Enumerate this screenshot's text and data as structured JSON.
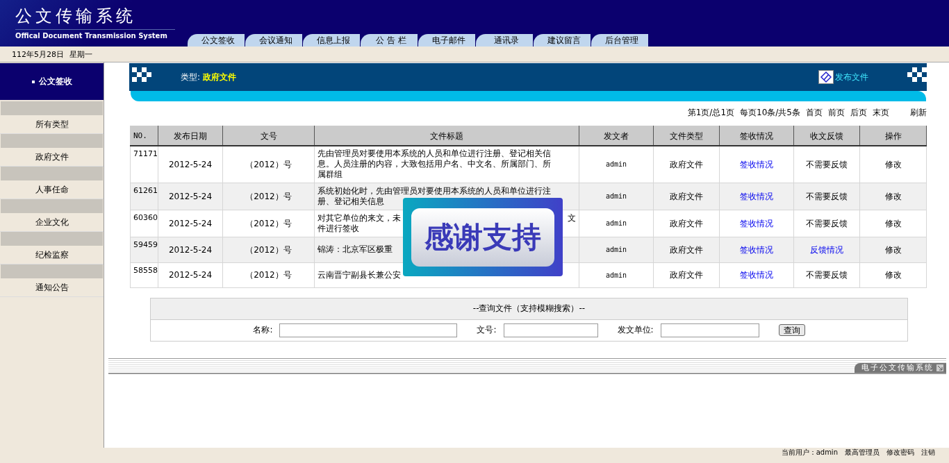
{
  "header": {
    "title": "公文传输系统",
    "subtitle": "Offical Document Transmission System"
  },
  "tabs": [
    "公文签收",
    "会议通知",
    "信息上报",
    "公 告 栏",
    "电子邮件",
    "通讯录",
    "建议留言",
    "后台管理"
  ],
  "date": {
    "day": "112年5月28日",
    "weekday": "星期一"
  },
  "sidebar": {
    "heading": "公文签收",
    "items": [
      "所有类型",
      "政府文件",
      "人事任命",
      "企业文化",
      "纪检监察",
      "通知公告"
    ]
  },
  "banner": {
    "type_label": "类型:",
    "type_value": "政府文件",
    "action": "发布文件"
  },
  "pagination": [
    {
      "label": "第1页/总1页",
      "kind": "text"
    },
    {
      "label": "每页10条/共5条",
      "kind": "text"
    },
    {
      "label": "首页",
      "kind": "link"
    },
    {
      "label": "前页",
      "kind": "link"
    },
    {
      "label": "后页",
      "kind": "link"
    },
    {
      "label": "末页",
      "kind": "link"
    },
    {
      "label": "刷新",
      "kind": "refresh"
    }
  ],
  "table": {
    "columns": [
      "NO.",
      "发布日期",
      "文号",
      "文件标题",
      "发文者",
      "文件类型",
      "签收情况",
      "收文反馈",
      "操作"
    ],
    "rows": [
      {
        "no": "71171",
        "date": "2012-5-24",
        "number": "（2012）号",
        "title_lines": [
          [
            "先由管理员对要使用本系统的人员和单位进行注册、登记相关信"
          ],
          [
            "息。人员注册的内容，大致包括用户名、中文名、所属部门、所"
          ],
          [
            "属群组"
          ]
        ],
        "sender": "admin",
        "type": "政府文件",
        "sign": "签收情况",
        "feedback": {
          "label": "不需要反馈",
          "kind": "text"
        },
        "op": "修改"
      },
      {
        "no": "61261",
        "date": "2012-5-24",
        "number": "（2012）号",
        "title_lines": [
          [
            "系统初始化时，先由管理员对要使用本系统的人员和单位进行注"
          ],
          [
            "册、登记相关信息"
          ]
        ],
        "sender": "admin",
        "type": "政府文件",
        "sign": "签收情况",
        "feedback": {
          "label": "不需要反馈",
          "kind": "text"
        },
        "op": "修改"
      },
      {
        "no": "60360",
        "date": "2012-5-24",
        "number": "（2012）号",
        "title_lines": [
          [
            "对其它单位的来文，未",
            "文"
          ],
          [
            "件进行签收"
          ]
        ],
        "sender": "admin",
        "type": "政府文件",
        "sign": "签收情况",
        "feedback": {
          "label": "不需要反馈",
          "kind": "text"
        },
        "op": "修改"
      },
      {
        "no": "59459",
        "date": "2012-5-24",
        "number": "（2012）号",
        "title_lines": [
          [
            "锦涛：北京军区极重"
          ]
        ],
        "sender": "admin",
        "type": "政府文件",
        "sign": "签收情况",
        "feedback": {
          "label": "反馈情况",
          "kind": "link"
        },
        "op": "修改"
      },
      {
        "no": "58558",
        "date": "2012-5-24",
        "number": "（2012）号",
        "title_lines": [
          [
            "云南晋宁副县长兼公安"
          ]
        ],
        "sender": "admin",
        "type": "政府文件",
        "sign": "签收情况",
        "feedback": {
          "label": "不需要反馈",
          "kind": "text"
        },
        "op": "修改"
      }
    ]
  },
  "search": {
    "title": "--查询文件（支持模糊搜索）--",
    "fields": [
      {
        "label": "名称:"
      },
      {
        "label": "文号:"
      },
      {
        "label": "发文单位:"
      }
    ],
    "button": "查询"
  },
  "footer_label": "电子公文传输系统",
  "overlay": {
    "text": "感谢支持"
  },
  "status": [
    "当前用户：admin",
    "最高管理员",
    "修改密码",
    "注销"
  ]
}
